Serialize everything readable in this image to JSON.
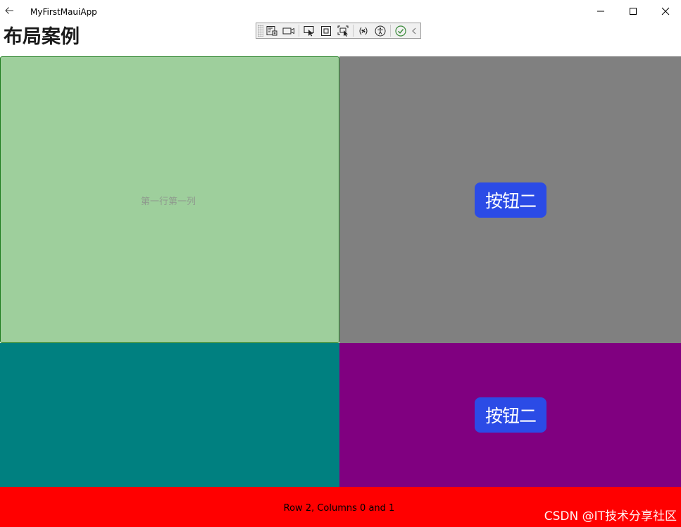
{
  "window": {
    "title": "MyFirstMauiApp"
  },
  "page": {
    "title": "布局案例"
  },
  "debug_toolbar": {
    "buttons": [
      "live-visual-tree-icon",
      "record-icon",
      "select-element-icon",
      "display-layout-adorners-icon",
      "track-focus-icon",
      "binding-failures-icon",
      "accessibility-icon",
      "check-icon",
      "collapse-chevron-icon"
    ]
  },
  "grid": {
    "cell_1_label": "第一行第一列",
    "button_top_label": "按钮二",
    "button_bottom_label": "按钮二",
    "row_2_label": "Row 2, Columns 0 and 1"
  },
  "watermark": "CSDN @IT技术分享社区",
  "colors": {
    "cell_1": "#9ecf9c",
    "cell_2": "#808080",
    "cell_3": "#008080",
    "cell_4": "#800080",
    "row_2": "#ff0000",
    "button": "#2b4be6"
  }
}
